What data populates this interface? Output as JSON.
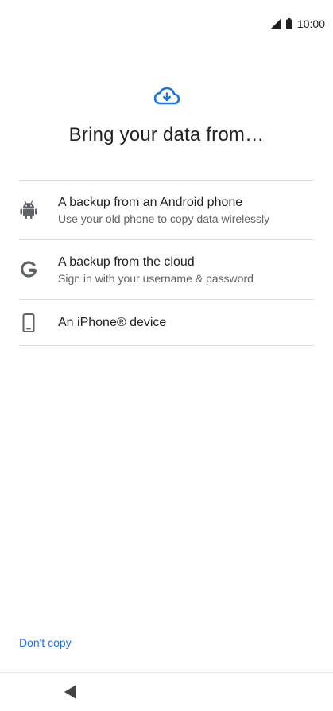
{
  "status_bar": {
    "time": "10:00",
    "signal_icon": "signal-icon",
    "battery_icon": "battery-icon"
  },
  "header": {
    "icon": "cloud-download-icon",
    "title": "Bring your data from…"
  },
  "options": [
    {
      "icon": "android-icon",
      "title": "A backup from an Android phone",
      "subtitle": "Use your old phone to copy data wirelessly"
    },
    {
      "icon": "google-g-icon",
      "title": "A backup from the cloud",
      "subtitle": "Sign in with your username & password"
    },
    {
      "icon": "phone-icon",
      "title": "An iPhone® device",
      "subtitle": ""
    }
  ],
  "footer": {
    "dont_copy_label": "Don't copy",
    "back_icon": "back-triangle-icon"
  },
  "colors": {
    "accent": "#1a73e8",
    "text_primary": "#202124",
    "text_secondary": "#5f6368",
    "divider": "#e0e0e0"
  }
}
